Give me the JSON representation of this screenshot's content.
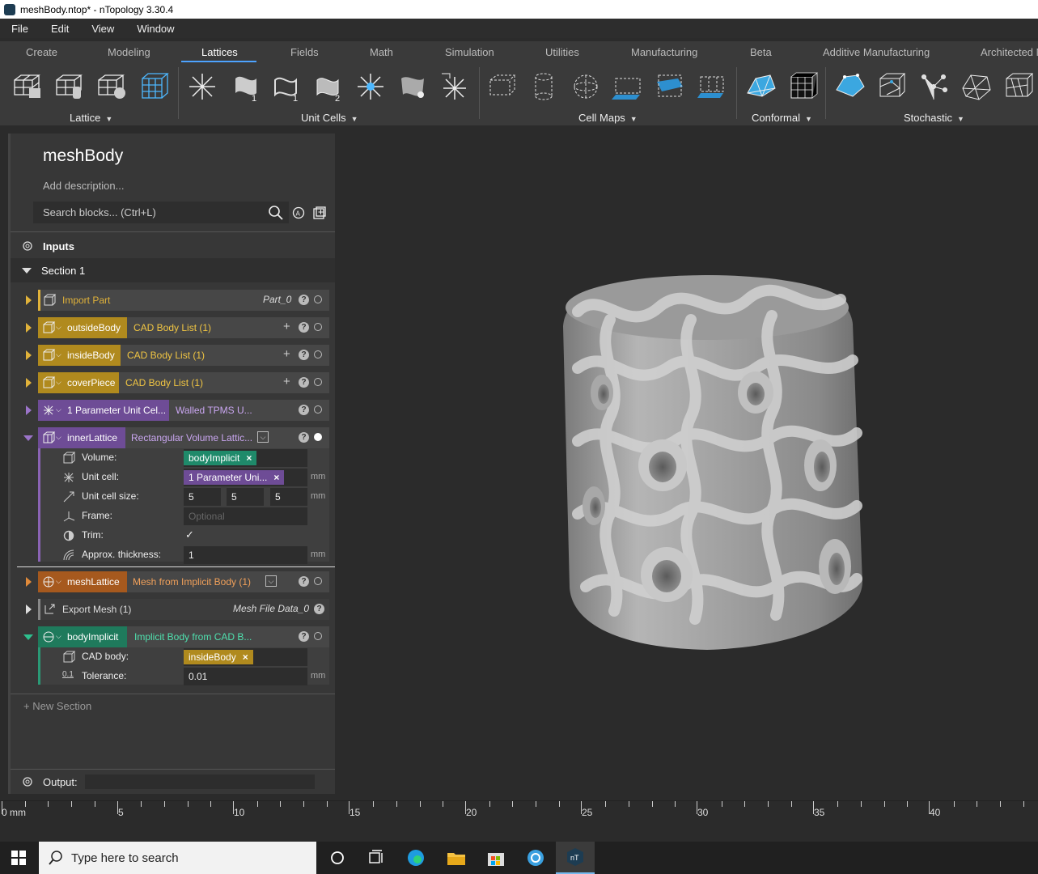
{
  "window": {
    "title": "meshBody.ntop* - nTopology 3.30.4"
  },
  "menu": [
    "File",
    "Edit",
    "View",
    "Window"
  ],
  "ribbon_tabs": [
    "Create",
    "Modeling",
    "Lattices",
    "Fields",
    "Math",
    "Simulation",
    "Utilities",
    "Manufacturing",
    "Beta",
    "Additive Manufacturing",
    "Architected M"
  ],
  "active_tab": "Lattices",
  "ribbon_groups": [
    "Lattice",
    "Unit Cells",
    "Cell Maps",
    "Conformal",
    "Stochastic"
  ],
  "panel": {
    "title": "meshBody",
    "description_placeholder": "Add description...",
    "search_placeholder": "Search blocks... (Ctrl+L)",
    "inputs_label": "Inputs",
    "section_label": "Section 1",
    "new_section": "+ New Section",
    "output_label": "Output:"
  },
  "blocks": {
    "import_part": {
      "name": "Import Part",
      "right": "Part_0"
    },
    "outside_body": {
      "name": "outsideBody",
      "type": "CAD Body List (1)"
    },
    "inside_body": {
      "name": "insideBody",
      "type": "CAD Body List (1)"
    },
    "cover_piece": {
      "name": "coverPiece",
      "type": "CAD Body List (1)"
    },
    "unit_cell": {
      "name": "1 Parameter Unit Cel...",
      "type": "Walled TPMS U..."
    },
    "inner_lattice": {
      "name": "innerLattice",
      "type": "Rectangular Volume Lattic..."
    },
    "mesh_lattice": {
      "name": "meshLattice",
      "type": "Mesh from Implicit Body (1)"
    },
    "export_mesh": {
      "name": "Export Mesh (1)",
      "right": "Mesh File Data_0"
    },
    "body_implicit": {
      "name": "bodyImplicit",
      "type": "Implicit Body from CAD B..."
    }
  },
  "inner_lattice_params": {
    "volume_label": "Volume:",
    "volume_value": "bodyImplicit",
    "unit_cell_label": "Unit cell:",
    "unit_cell_value": "1 Parameter Uni...",
    "size_label": "Unit cell size:",
    "size_x": "5",
    "size_y": "5",
    "size_z": "5",
    "frame_label": "Frame:",
    "frame_placeholder": "Optional",
    "trim_label": "Trim:",
    "trim_value": "✓",
    "thickness_label": "Approx. thickness:",
    "thickness_value": "1",
    "unit": "mm"
  },
  "body_implicit_params": {
    "cad_label": "CAD body:",
    "cad_value": "insideBody",
    "tol_label": "Tolerance:",
    "tol_value": "0.01",
    "unit": "mm"
  },
  "ruler": {
    "labels": [
      "0 mm",
      "5",
      "10",
      "15",
      "20",
      "25",
      "30",
      "35",
      "40"
    ]
  },
  "taskbar": {
    "search_placeholder": "Type here to search"
  },
  "colors": {
    "gold": "#c9a227",
    "purple": "#8a63b4",
    "orange": "#c8702a",
    "green": "#2a9a76",
    "accent": "#4da3ff"
  }
}
